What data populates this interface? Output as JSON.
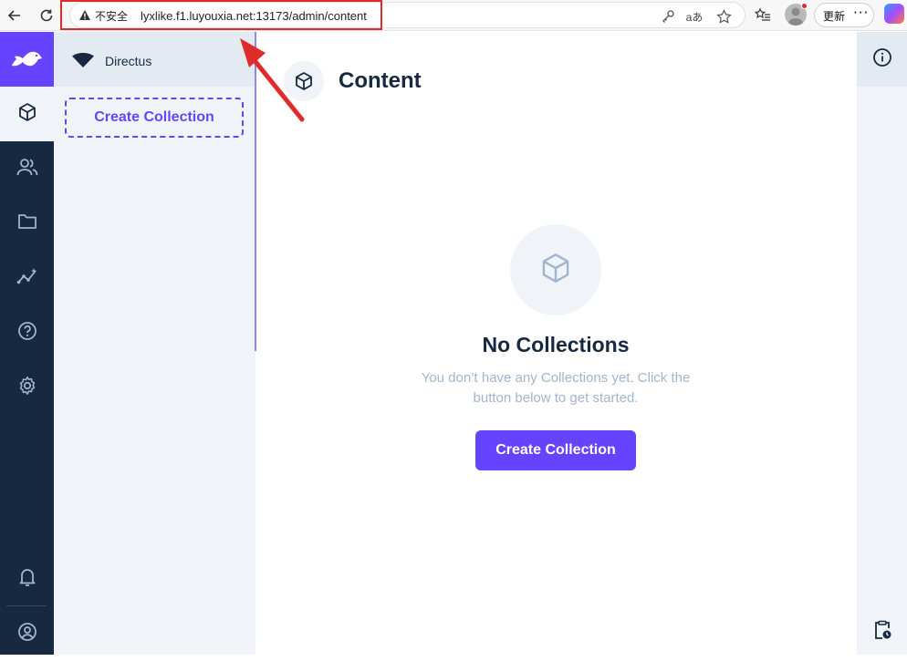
{
  "browser": {
    "security_label": "不安全",
    "url": "lyxlike.f1.luyouxia.net:13173/admin/content",
    "update_label": "更新",
    "more_label": "···",
    "read_aloud_label": "aあ"
  },
  "modules": [
    {
      "name": "content",
      "icon": "cube-icon",
      "active": true
    },
    {
      "name": "users",
      "icon": "users-icon",
      "active": false
    },
    {
      "name": "files",
      "icon": "folder-icon",
      "active": false
    },
    {
      "name": "insights",
      "icon": "insights-icon",
      "active": false
    },
    {
      "name": "docs",
      "icon": "help-icon",
      "active": false
    },
    {
      "name": "settings",
      "icon": "gear-icon",
      "active": false
    }
  ],
  "sidebar": {
    "project_name": "Directus",
    "create_collection_label": "Create Collection"
  },
  "main": {
    "title": "Content",
    "empty_state": {
      "title": "No Collections",
      "description": "You don’t have any Collections yet. Click the button below to get started.",
      "button_label": "Create Collection"
    }
  },
  "colors": {
    "accent": "#6644ff",
    "module_bar": "#172940",
    "nav_bg": "#f0f4f9",
    "muted_text": "#a2b5cd",
    "annotation": "#e02b2b"
  }
}
